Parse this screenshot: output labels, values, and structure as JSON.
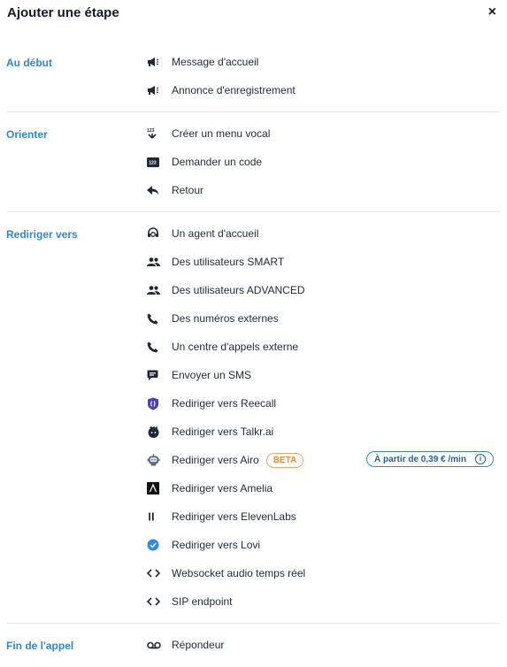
{
  "dialog": {
    "title": "Ajouter une étape",
    "close": "×"
  },
  "sections": {
    "au_debut": {
      "label": "Au début",
      "items": [
        {
          "label": "Message d'accueil",
          "icon": "megaphone-icon"
        },
        {
          "label": "Annonce d'enregistrement",
          "icon": "megaphone-icon"
        }
      ]
    },
    "orienter": {
      "label": "Orienter",
      "items": [
        {
          "label": "Créer un menu vocal",
          "icon": "dialpad-123-icon"
        },
        {
          "label": "Demander un code",
          "icon": "code-123-icon"
        },
        {
          "label": "Retour",
          "icon": "reply-arrow-icon"
        }
      ]
    },
    "rediriger": {
      "label": "Rediriger vers",
      "items": [
        {
          "label": "Un agent d'accueil",
          "icon": "headset-agent-icon"
        },
        {
          "label": "Des utilisateurs SMART",
          "icon": "users-icon"
        },
        {
          "label": "Des utilisateurs ADVANCED",
          "icon": "users-icon"
        },
        {
          "label": "Des numéros externes",
          "icon": "phone-icon"
        },
        {
          "label": "Un centre d'appels externe",
          "icon": "phone-icon"
        },
        {
          "label": "Envoyer un SMS",
          "icon": "sms-bubble-icon"
        },
        {
          "label": "Rediriger vers Reecall",
          "icon": "reecall-logo-icon"
        },
        {
          "label": "Rediriger vers Talkr.ai",
          "icon": "talkr-logo-icon"
        },
        {
          "label": "Rediriger vers Airo",
          "icon": "airo-robot-icon",
          "badge": "BETA",
          "price": "À partir de 0,39 € /min",
          "info": "i"
        },
        {
          "label": "Rediriger vers Amelia",
          "icon": "amelia-logo-icon"
        },
        {
          "label": "Rediriger vers ElevenLabs",
          "icon": "elevenlabs-logo-icon"
        },
        {
          "label": "Rediriger vers Lovi",
          "icon": "lovi-check-icon"
        },
        {
          "label": "Websocket audio temps réel",
          "icon": "code-brackets-icon"
        },
        {
          "label": "SIP endpoint",
          "icon": "code-brackets-icon"
        }
      ]
    },
    "fin": {
      "label": "Fin de l'appel",
      "items": [
        {
          "label": "Répondeur",
          "icon": "voicemail-icon"
        }
      ]
    }
  },
  "colors": {
    "accent": "#2f86d6",
    "beta": "#f08c3a",
    "reecall": "#4b3fb8",
    "lovi": "#2b8be8"
  }
}
